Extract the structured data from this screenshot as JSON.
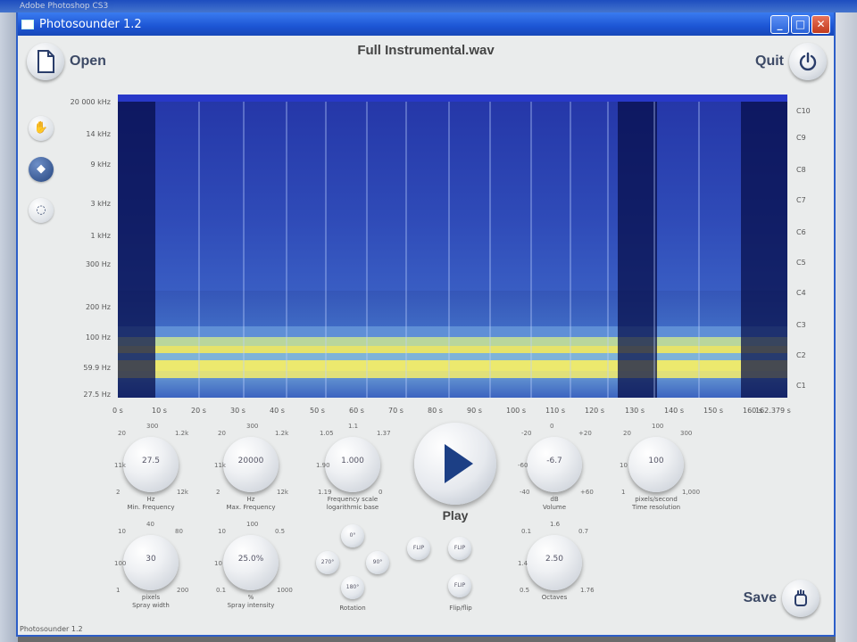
{
  "outer_window": {
    "title": "Adobe Photoshop CS3"
  },
  "window": {
    "title": "Photosounder 1.2",
    "controls": {
      "minimize": "_",
      "maximize": "□",
      "close": "✕"
    }
  },
  "toolbar": {
    "open_label": "Open",
    "open_icon": "document-icon",
    "quit_label": "Quit",
    "quit_icon": "power-icon",
    "save_label": "Save",
    "save_icon": "hand-icon"
  },
  "file_name": "Full Instrumental.wav",
  "side_tools": [
    {
      "name": "hand-tool-icon",
      "glyph": "✋",
      "active": false
    },
    {
      "name": "bucket-tool-icon",
      "glyph": "◆",
      "active": true
    },
    {
      "name": "erase-tool-icon",
      "glyph": "◌",
      "active": false
    }
  ],
  "spectrogram": {
    "freq_labels": [
      "20 000 kHz",
      "14 kHz",
      "9 kHz",
      "3 kHz",
      "1 kHz",
      "300 Hz",
      "200 Hz",
      "100 Hz",
      "59.9 Hz",
      "27.5 Hz"
    ],
    "note_labels": [
      "C10",
      "C9",
      "C8",
      "C7",
      "C6",
      "C5",
      "C4",
      "C3",
      "C2",
      "C1"
    ],
    "time_labels": [
      "0 s",
      "10 s",
      "20 s",
      "30 s",
      "40 s",
      "50 s",
      "60 s",
      "70 s",
      "80 s",
      "90 s",
      "100 s",
      "110 s",
      "120 s",
      "130 s",
      "140 s",
      "150 s",
      "160 s",
      "162.379 s"
    ],
    "colors": {
      "low": "#1b2b98",
      "mid": "#5b8fe0",
      "high": "#e8e870"
    }
  },
  "knobs": [
    {
      "id": "min-frequency",
      "value": "27.5",
      "label": "Hz\nMin. Frequency",
      "ticks": [
        "20",
        "300",
        "1.2k",
        "11k",
        "2",
        "12k"
      ]
    },
    {
      "id": "max-frequency",
      "value": "20000",
      "label": "Hz\nMax. Frequency",
      "ticks": [
        "20",
        "300",
        "1.2k",
        "11k",
        "2",
        "12k"
      ]
    },
    {
      "id": "frequency-scale",
      "value": "1.000",
      "label": "Frequency scale\nlogarithmic base",
      "ticks": [
        "1.05",
        "1.1",
        "1.37",
        "1.90",
        "1.19",
        "0"
      ]
    },
    {
      "id": "volume",
      "value": "-6.7",
      "label": "dB\nVolume",
      "ticks": [
        "-20",
        "0",
        "+20",
        "-60",
        "-40",
        "+60"
      ]
    },
    {
      "id": "pixels-per-second",
      "value": "100",
      "label": "pixels/second\nTime resolution",
      "ticks": [
        "20",
        "100",
        "300",
        "10",
        "1",
        "1,000"
      ]
    },
    {
      "id": "spray-width",
      "value": "30",
      "label": "pixels\nSpray width",
      "ticks": [
        "10",
        "40",
        "80",
        "100",
        "1",
        "200"
      ]
    },
    {
      "id": "spray-intensity",
      "value": "25.0%",
      "label": "%\nSpray intensity",
      "ticks": [
        "10",
        "100",
        "0.5",
        "10",
        "0.1",
        "1000"
      ]
    },
    {
      "id": "cutoff",
      "value": "2.50",
      "label": "Octaves",
      "ticks": [
        "0.1",
        "1.6",
        "0.7",
        "1.4",
        "0.5",
        "1.76"
      ]
    }
  ],
  "play": {
    "label": "Play"
  },
  "rotation": {
    "label": "Rotation",
    "buttons": [
      "0°",
      "270°",
      "90°",
      "180°"
    ]
  },
  "flip": {
    "label": "Flip/flip",
    "buttons": [
      "FLIP",
      "FLIP",
      "FLIP"
    ]
  },
  "footer": {
    "text": "Photosounder 1.2"
  }
}
